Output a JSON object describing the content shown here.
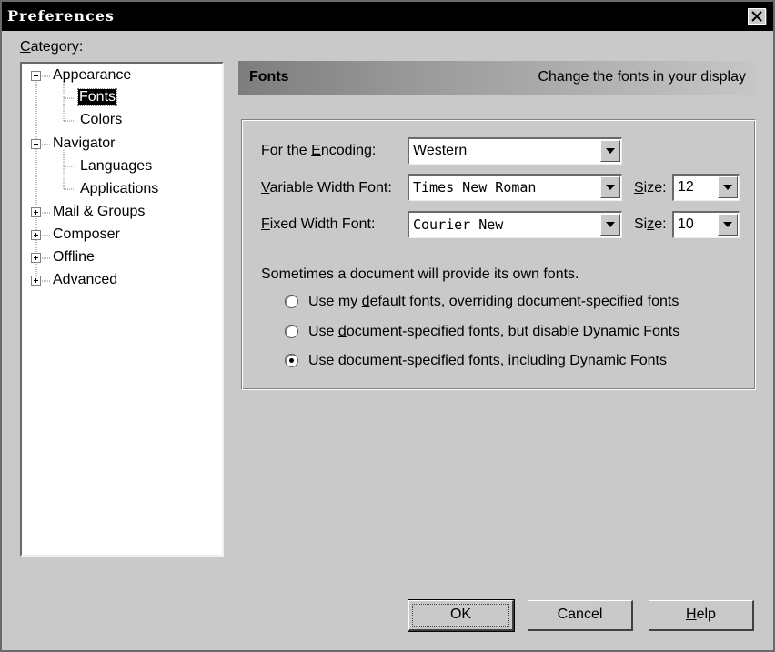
{
  "window": {
    "title": "Preferences"
  },
  "category": {
    "label_prefix": "",
    "label_underlined": "C",
    "label_rest": "ategory:"
  },
  "tree": [
    {
      "label": "Appearance",
      "expander": "-"
    },
    {
      "label": "Fonts",
      "selected": true
    },
    {
      "label": "Colors"
    },
    {
      "label": "Navigator",
      "expander": "-"
    },
    {
      "label": "Languages"
    },
    {
      "label": "Applications"
    },
    {
      "label": "Mail & Groups",
      "expander": "+"
    },
    {
      "label": "Composer",
      "expander": "+"
    },
    {
      "label": "Offline",
      "expander": "+"
    },
    {
      "label": "Advanced",
      "expander": "+"
    }
  ],
  "header": {
    "title": "Fonts",
    "description": "Change the fonts in your display"
  },
  "encoding": {
    "label_a": "For the ",
    "label_u": "E",
    "label_b": "ncoding:",
    "value": "Western"
  },
  "variable_font": {
    "label_u": "V",
    "label_b": "ariable Width Font:",
    "value": "Times New Roman",
    "size_label_u": "S",
    "size_label_b": "ize:",
    "size_value": "12"
  },
  "fixed_font": {
    "label_u": "F",
    "label_b": "ixed Width Font:",
    "value": "Courier New",
    "size_label_a": "Si",
    "size_label_u": "z",
    "size_label_b": "e:",
    "size_value": "10"
  },
  "document_fonts": {
    "intro": "Sometimes a document will provide its own fonts.",
    "options": [
      {
        "a": "Use my ",
        "u": "d",
        "b": "efault fonts, overriding document-specified fonts",
        "checked": false
      },
      {
        "a": "Use ",
        "u": "d",
        "b": "ocument-specified fonts, but disable Dynamic Fonts",
        "checked": false
      },
      {
        "a": "Use document-specified fonts, in",
        "u": "c",
        "b": "luding Dynamic Fonts",
        "checked": true
      }
    ]
  },
  "buttons": {
    "ok": "OK",
    "cancel": "Cancel",
    "help_u": "H",
    "help_b": "elp"
  }
}
